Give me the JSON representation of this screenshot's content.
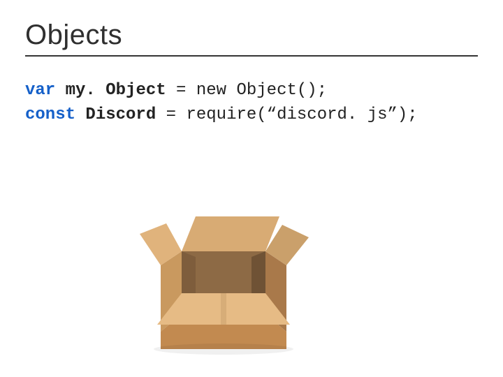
{
  "slide": {
    "title": "Objects",
    "code": {
      "line1": {
        "kw": "var",
        "ident": "my. Object",
        "rest": " = new Object();"
      },
      "line2": {
        "kw": "const",
        "ident": "Discord",
        "rest": " = require(“discord. js”);"
      }
    },
    "image": {
      "name": "open-cardboard-box"
    }
  }
}
